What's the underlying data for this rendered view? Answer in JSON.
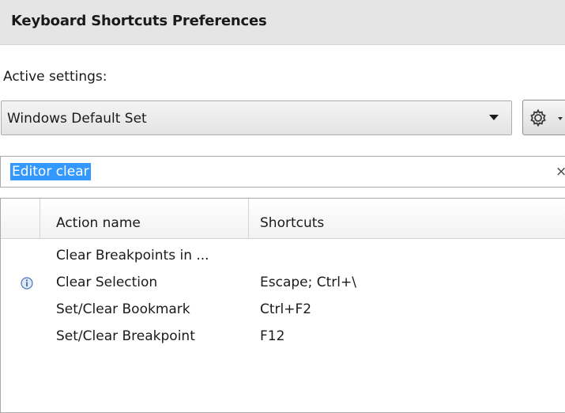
{
  "header": {
    "title": "Keyboard Shortcuts Preferences"
  },
  "settings": {
    "active_label": "Active settings:",
    "scheme_value": "Windows Default Set"
  },
  "search": {
    "value": "Editor clear",
    "clear_glyph": "×"
  },
  "table": {
    "columns": [
      "Action name",
      "Shortcuts"
    ],
    "rows": [
      {
        "action": "Clear Breakpoints in ...",
        "shortcut": "",
        "icon": ""
      },
      {
        "action": "Clear Selection",
        "shortcut": "Escape; Ctrl+\\",
        "icon": "info-icon"
      },
      {
        "action": "Set/Clear Bookmark",
        "shortcut": "Ctrl+F2",
        "icon": ""
      },
      {
        "action": "Set/Clear Breakpoint",
        "shortcut": "F12",
        "icon": ""
      }
    ]
  },
  "icons": {
    "scheme_dropdown": "chevron-down-icon",
    "options_button": "gear-icon",
    "clear_search": "close-icon",
    "row_marker": "info-icon"
  },
  "colors": {
    "header_bg": "#e5e5e5",
    "selection_bg": "#3399ff",
    "icon_blue": "#4a78b8"
  }
}
